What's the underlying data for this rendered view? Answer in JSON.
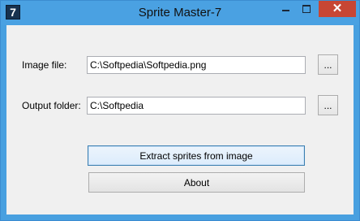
{
  "window": {
    "icon_text": "7",
    "title": "Sprite Master-7",
    "close_glyph": "✕"
  },
  "form": {
    "image_file_label": "Image file:",
    "image_file_value": "C:\\Softpedia\\Softpedia.png",
    "output_folder_label": "Output folder:",
    "output_folder_value": "C:\\Softpedia",
    "browse_label": "..."
  },
  "buttons": {
    "extract_label": "Extract sprites from image",
    "about_label": "About"
  },
  "colors": {
    "titlebar": "#4aa1e2",
    "close_button": "#c74634",
    "client_background": "#f0f0f0",
    "focused_button_border": "#3c7fb1"
  },
  "icons": [
    "app-icon",
    "minimize-icon",
    "maximize-icon",
    "close-icon"
  ]
}
